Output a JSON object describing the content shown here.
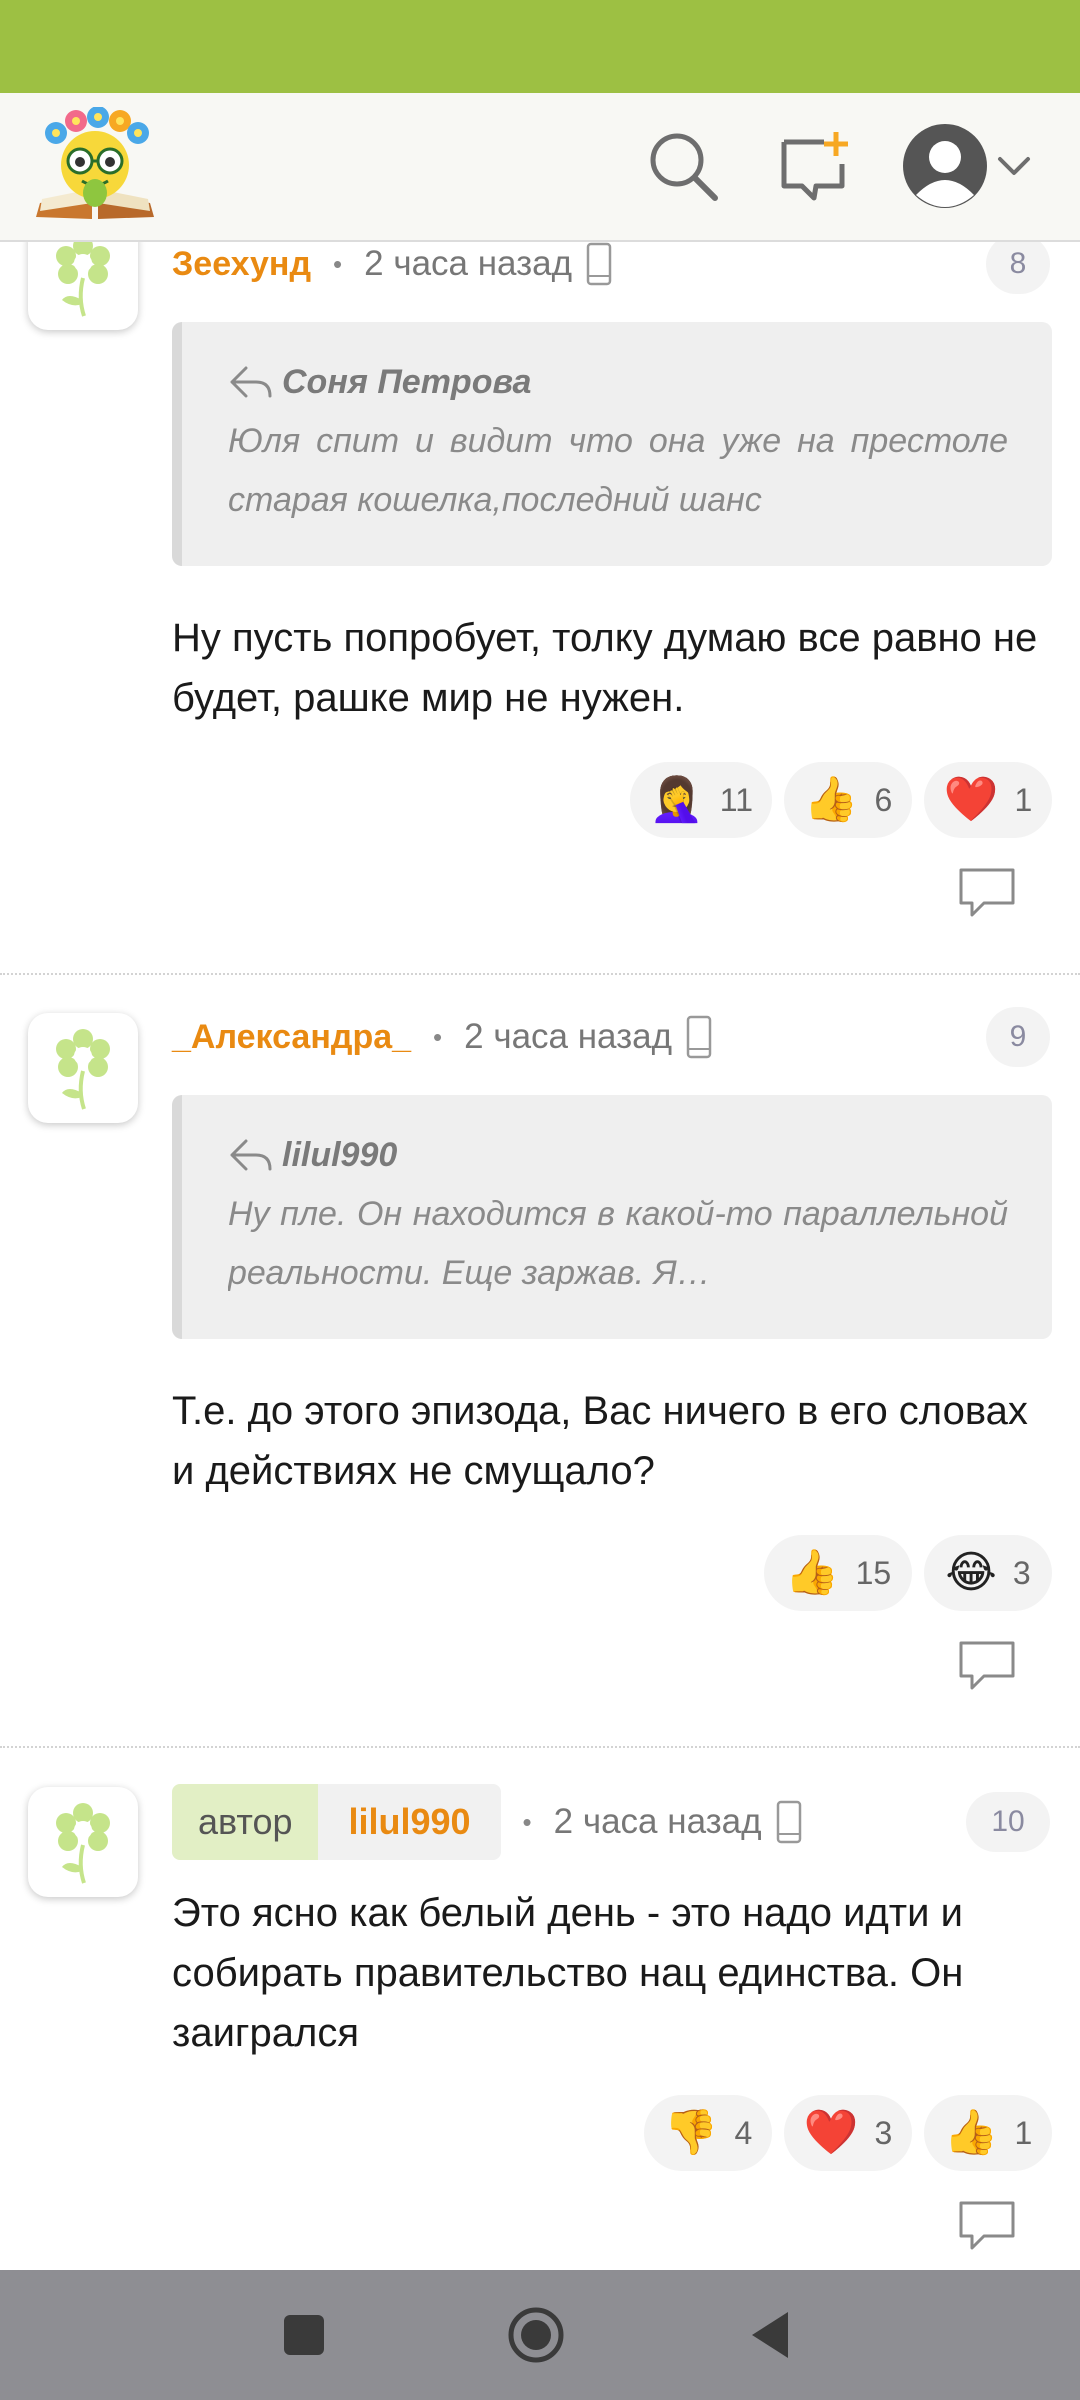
{
  "comments": [
    {
      "author": "Зеехунд",
      "time": "2 часа назад",
      "number": "8",
      "quote": {
        "author": "Соня Петрова",
        "text": "Юля спит и видит что она уже на престоле старая кошелка,последний шанс"
      },
      "body": "Ну пусть попробует, толку думаю все равно не будет, рашке мир не нужен.",
      "reactions": [
        {
          "emoji": "🤦‍♀️",
          "count": "11",
          "icon": "facepalm-icon"
        },
        {
          "emoji": "👍",
          "count": "6",
          "icon": "thumbs-up-icon"
        },
        {
          "emoji": "❤️",
          "count": "1",
          "icon": "heart-icon"
        }
      ]
    },
    {
      "author": "_Александра_",
      "time": "2 часа назад",
      "number": "9",
      "quote": {
        "author": "lilul990",
        "text": "Ну пле. Он находится в какой-то параллельной реальности. Еще заржав. Я…"
      },
      "body": "Т.е. до этого эпизода, Вас ничего в его словах и действиях не смущало?",
      "reactions": [
        {
          "emoji": "👍",
          "count": "15",
          "icon": "thumbs-up-icon"
        },
        {
          "emoji": "😂",
          "count": "3",
          "icon": "laughing-icon"
        }
      ]
    },
    {
      "author_tag": "автор",
      "author": "lilul990",
      "time": "2 часа назад",
      "number": "10",
      "body": "Это ясно как белый день - это надо идти и собирать правительство нац единства. Он заигрался",
      "reactions": [
        {
          "emoji": "👎",
          "count": "4",
          "icon": "thumbs-down-icon"
        },
        {
          "emoji": "❤️",
          "count": "3",
          "icon": "heart-icon"
        },
        {
          "emoji": "👍",
          "count": "1",
          "icon": "thumbs-up-icon"
        }
      ]
    }
  ],
  "colors": {
    "status_bar": "#9dc043",
    "author_name": "#e98a12",
    "author_tag_bg": "#e2efc5",
    "nav_bar": "#8e8e93"
  }
}
